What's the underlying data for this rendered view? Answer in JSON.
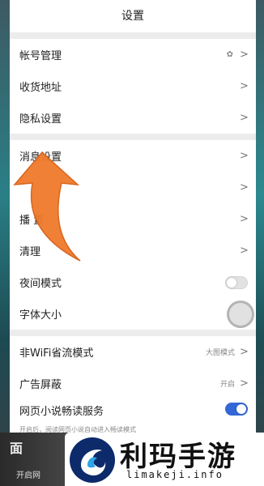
{
  "header": {
    "title": "设置"
  },
  "group1": [
    {
      "label": "帐号管理",
      "value": "",
      "chevron": ">"
    },
    {
      "label": "收货地址",
      "value": "",
      "chevron": ">"
    },
    {
      "label": "隐私设置",
      "value": "",
      "chevron": ">"
    }
  ],
  "group2": [
    {
      "label": "消息设置",
      "value": "",
      "chevron": ">"
    },
    {
      "label": "",
      "value": "",
      "chevron": ">"
    },
    {
      "label": "播   置",
      "value": "",
      "chevron": ">"
    },
    {
      "label": "清理",
      "value": "",
      "chevron": ">"
    },
    {
      "label": "夜间模式",
      "toggle": false
    },
    {
      "label": "字体大小",
      "value": ""
    }
  ],
  "group3": [
    {
      "label": "非WiFi省流模式",
      "value": "大图模式",
      "chevron": ">"
    },
    {
      "label": "广告屏蔽",
      "value": "开启",
      "chevron": ">"
    },
    {
      "label": "网页小说畅读服务",
      "sub": "开启后，阅读网页小说自动进入畅读模式",
      "toggle": true
    }
  ],
  "overlay": {
    "video_text": "面",
    "video_button": "开启网",
    "brand_title": "利玛手游",
    "brand_url": "limakeji.info"
  },
  "colors": {
    "accent": "#3467d6",
    "arrow": "#f07a2c",
    "logo_bg": "#0d2a6b"
  }
}
